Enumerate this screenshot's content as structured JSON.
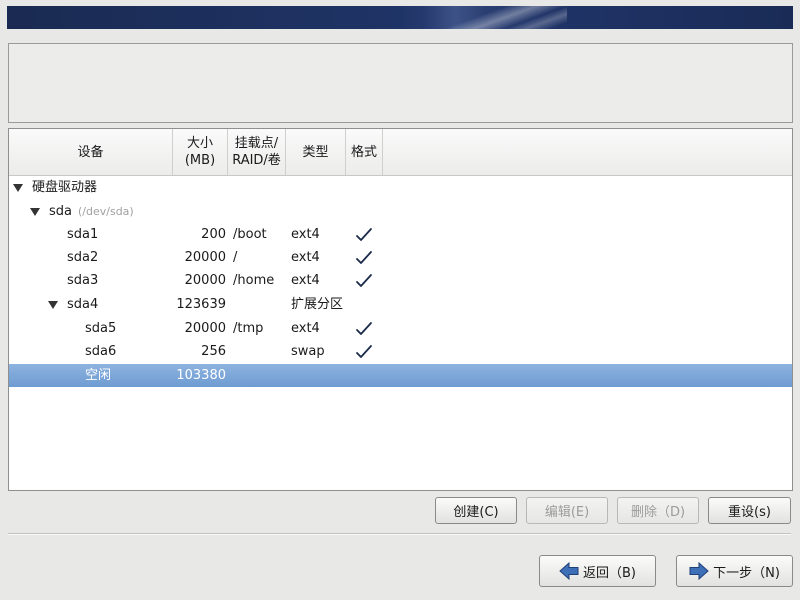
{
  "columns": {
    "device": "设备",
    "size": "大小\n(MB)",
    "mount": "挂载点/\nRAID/卷",
    "type": "类型",
    "format": "格式"
  },
  "tree": {
    "hard_drives": "硬盘驱动器",
    "disk_name": "sda",
    "disk_path": "(/dev/sda)",
    "rows": [
      {
        "device": "sda1",
        "size": "200",
        "mount": "/boot",
        "type": "ext4",
        "format": true
      },
      {
        "device": "sda2",
        "size": "20000",
        "mount": "/",
        "type": "ext4",
        "format": true
      },
      {
        "device": "sda3",
        "size": "20000",
        "mount": "/home",
        "type": "ext4",
        "format": true
      },
      {
        "device": "sda4",
        "size": "123639",
        "mount": "",
        "type": "扩展分区",
        "format": false
      },
      {
        "device": "sda5",
        "size": "20000",
        "mount": "/tmp",
        "type": "ext4",
        "format": true
      },
      {
        "device": "sda6",
        "size": "256",
        "mount": "",
        "type": "swap",
        "format": true
      },
      {
        "device": "空闲",
        "size": "103380",
        "mount": "",
        "type": "",
        "format": false,
        "selected": true
      }
    ]
  },
  "actions": {
    "create": "创建(C)",
    "edit": "编辑(E)",
    "delete": "删除（D)",
    "reset": "重设(s)"
  },
  "nav": {
    "back": "返回（B)",
    "next": "下一步（N)"
  },
  "colors": {
    "selection": "#7aa6d9",
    "banner": "#1f3366"
  }
}
